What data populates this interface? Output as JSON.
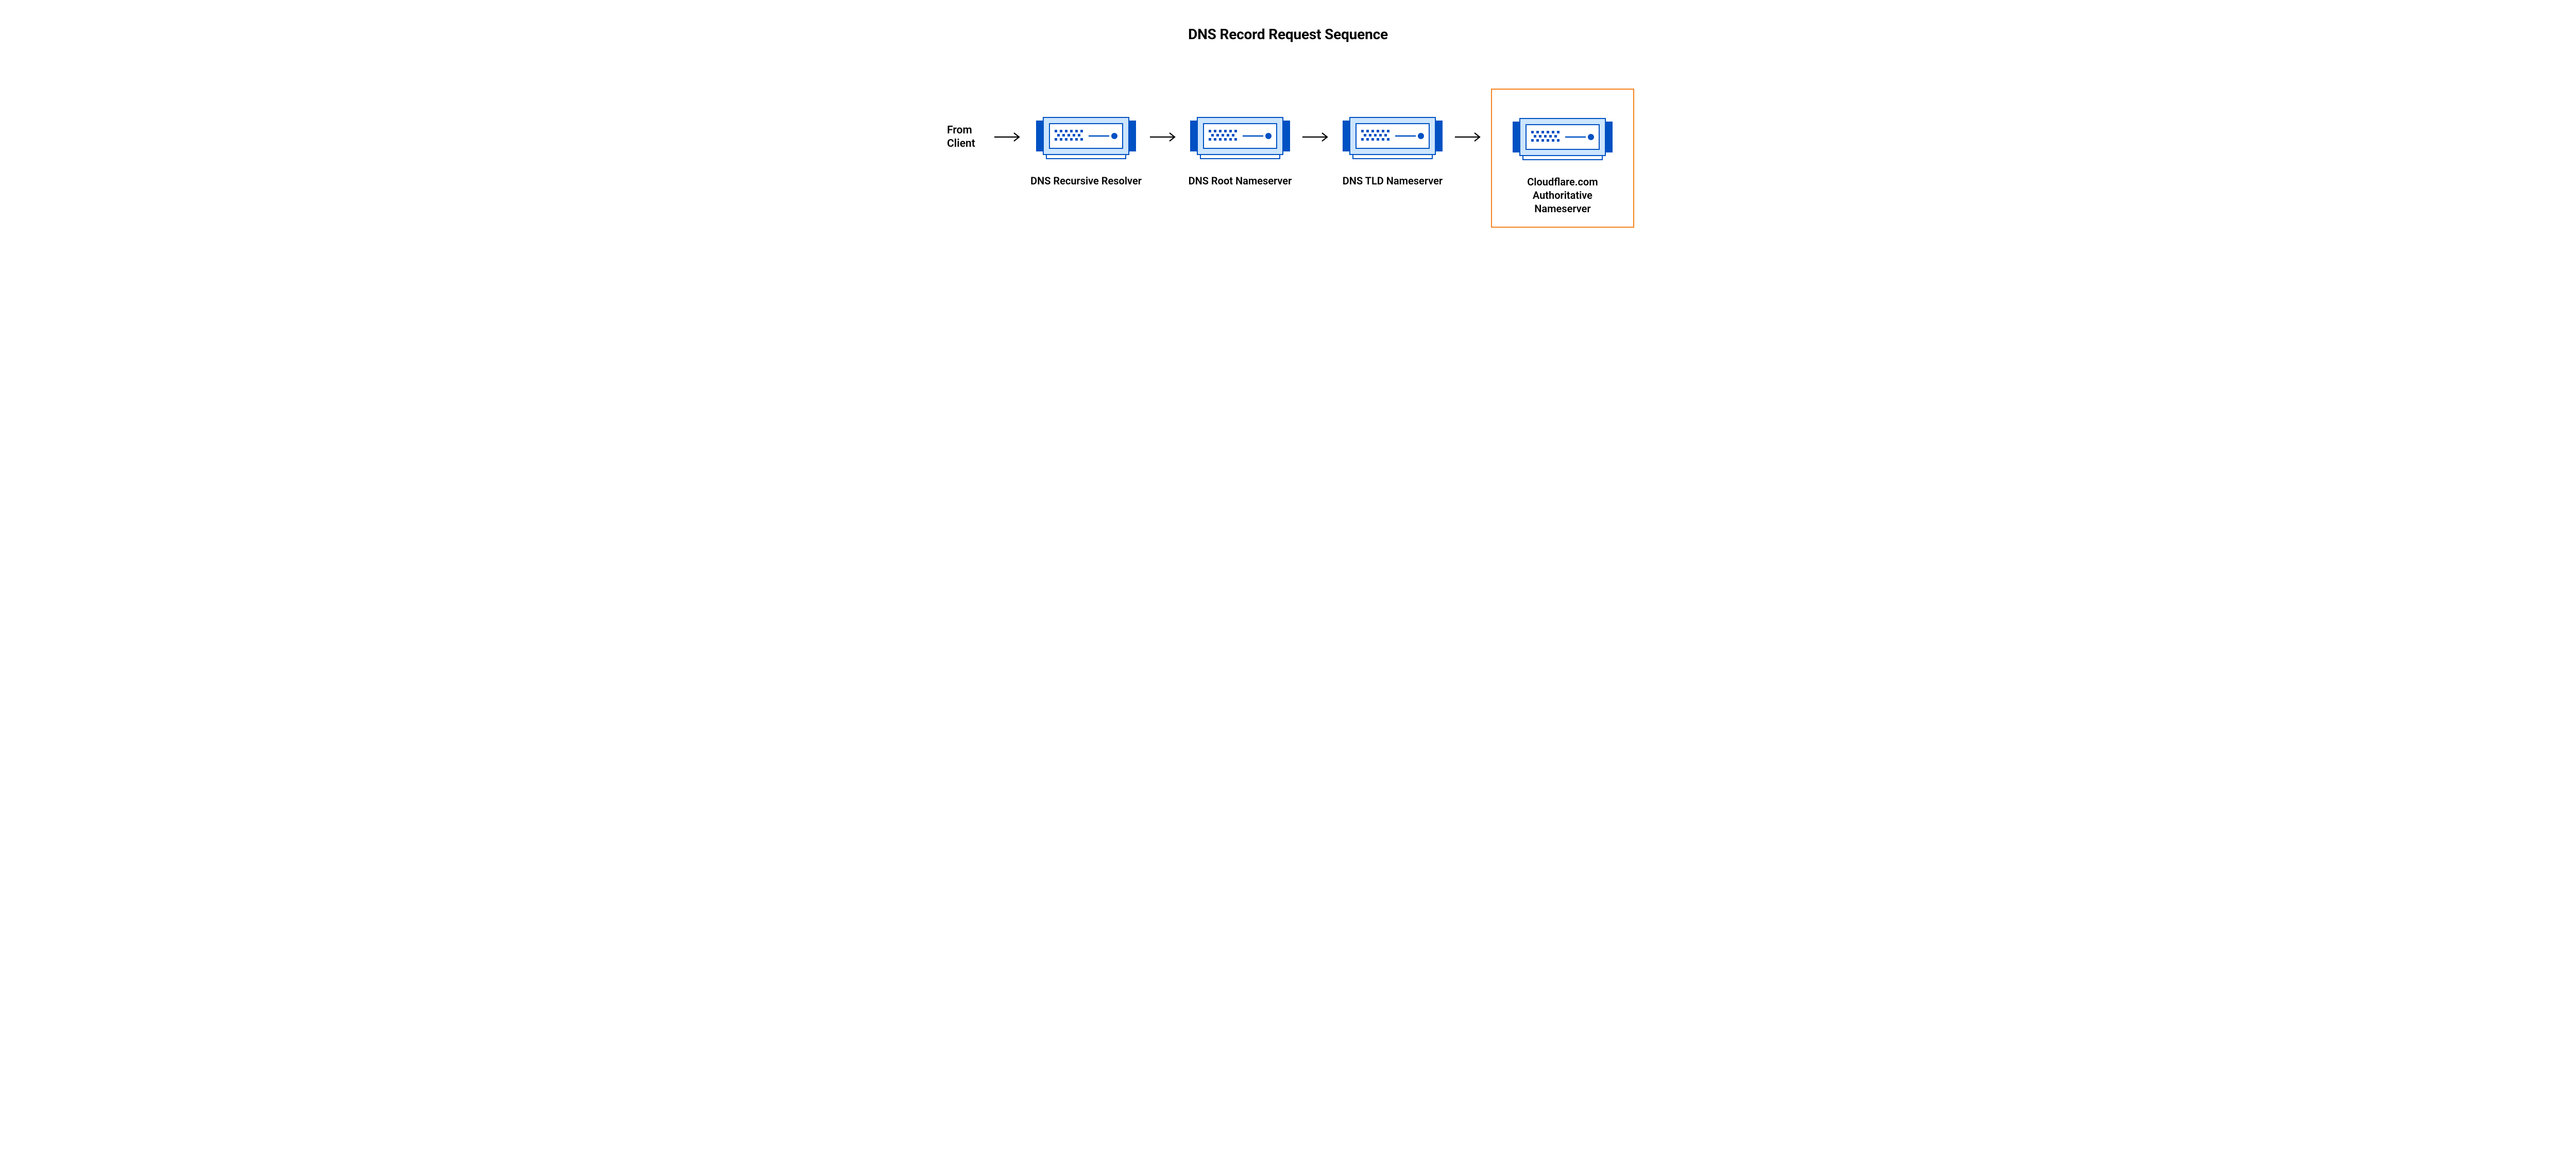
{
  "title": "DNS Record Request Sequence",
  "source_label": "From Client",
  "nodes": [
    {
      "label": "DNS Recursive Resolver",
      "highlighted": false
    },
    {
      "label": "DNS Root Nameserver",
      "highlighted": false
    },
    {
      "label": "DNS TLD Nameserver",
      "highlighted": false
    },
    {
      "label": "Cloudflare.com Authoritative Nameserver",
      "highlighted": true
    }
  ],
  "colors": {
    "server_outline": "#0051C3",
    "server_light": "#CCE5FF",
    "server_white": "#FFFFFF",
    "highlight": "#F6821F",
    "arrow": "#000000"
  }
}
